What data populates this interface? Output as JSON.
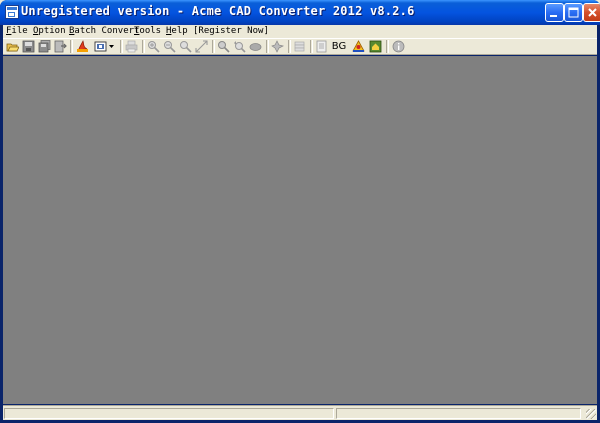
{
  "window": {
    "title": "Unregistered version - Acme CAD Converter 2012 v8.2.6"
  },
  "menubar": {
    "items": [
      {
        "pre": "",
        "key": "F",
        "post": "ile"
      },
      {
        "pre": "",
        "key": "O",
        "post": "ption"
      },
      {
        "pre": "",
        "key": "B",
        "post": "atch Convert"
      },
      {
        "pre": "",
        "key": "T",
        "post": "ools"
      },
      {
        "pre": "",
        "key": "H",
        "post": "elp"
      },
      {
        "pre": "[Register Now]",
        "key": "",
        "post": ""
      }
    ]
  },
  "toolbar": {
    "bg_label": "BG",
    "icons": [
      "open-icon",
      "save-icon",
      "save-all-icon",
      "export-icon",
      "pdf-convert-icon",
      "batch-convert-icon",
      "print-icon",
      "zoom-in-icon",
      "zoom-out-icon",
      "zoom-realtime-icon",
      "zoom-extents-icon",
      "zoom-window-icon",
      "zoom-previous-icon",
      "pan-icon",
      "layer-icon",
      "list-icon",
      "bg-toggle",
      "measure-icon",
      "home-icon",
      "info-icon"
    ]
  },
  "colors": {
    "canvas": "#808080",
    "chrome": "#ece9d8",
    "titlebar": "#0454e0"
  }
}
